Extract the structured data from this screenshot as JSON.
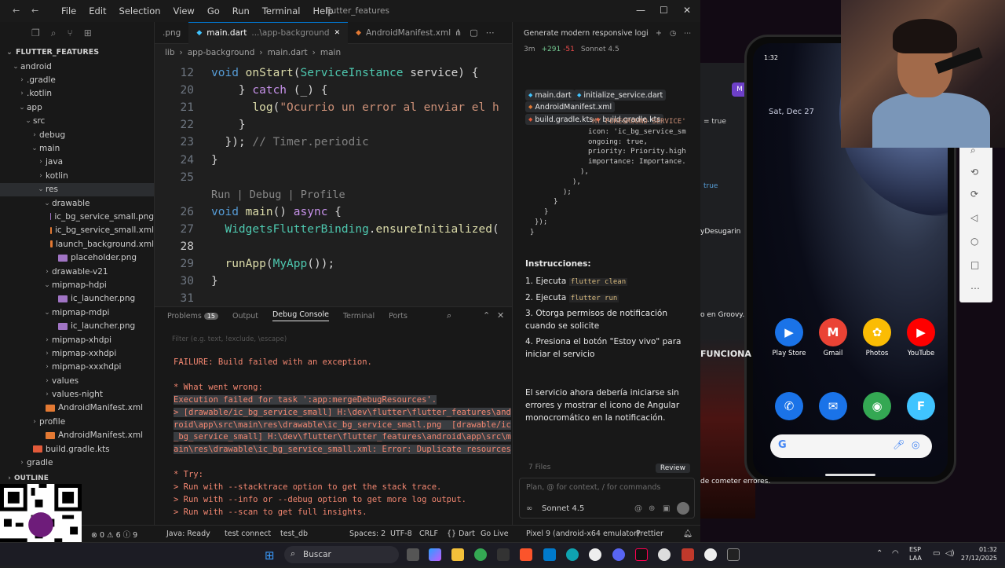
{
  "titlebar": {
    "menu": [
      "File",
      "Edit",
      "Selection",
      "View",
      "Go",
      "Run",
      "Terminal",
      "Help"
    ],
    "title": "flutter_features"
  },
  "explorer": {
    "root": "FLUTTER_FEATURES",
    "items": [
      {
        "label": "android",
        "indent": 1,
        "chev": "⌄",
        "icon": ""
      },
      {
        "label": ".gradle",
        "indent": 2,
        "chev": "›",
        "icon": ""
      },
      {
        "label": ".kotlin",
        "indent": 2,
        "chev": "›",
        "icon": ""
      },
      {
        "label": "app",
        "indent": 2,
        "chev": "⌄",
        "icon": ""
      },
      {
        "label": "src",
        "indent": 3,
        "chev": "⌄",
        "icon": ""
      },
      {
        "label": "debug",
        "indent": 4,
        "chev": "›",
        "icon": ""
      },
      {
        "label": "main",
        "indent": 4,
        "chev": "⌄",
        "icon": ""
      },
      {
        "label": "java",
        "indent": 5,
        "chev": "›",
        "icon": ""
      },
      {
        "label": "kotlin",
        "indent": 5,
        "chev": "›",
        "icon": ""
      },
      {
        "label": "res",
        "indent": 5,
        "chev": "⌄",
        "icon": "",
        "selected": true
      },
      {
        "label": "drawable",
        "indent": 6,
        "chev": "⌄",
        "icon": ""
      },
      {
        "label": "ic_bg_service_small.png",
        "indent": 7,
        "chev": "",
        "icon": "img"
      },
      {
        "label": "ic_bg_service_small.xml",
        "indent": 7,
        "chev": "",
        "icon": "xml"
      },
      {
        "label": "launch_background.xml",
        "indent": 7,
        "chev": "",
        "icon": "xml"
      },
      {
        "label": "placeholder.png",
        "indent": 7,
        "chev": "",
        "icon": "img"
      },
      {
        "label": "drawable-v21",
        "indent": 6,
        "chev": "›",
        "icon": ""
      },
      {
        "label": "mipmap-hdpi",
        "indent": 6,
        "chev": "⌄",
        "icon": ""
      },
      {
        "label": "ic_launcher.png",
        "indent": 7,
        "chev": "",
        "icon": "img"
      },
      {
        "label": "mipmap-mdpi",
        "indent": 6,
        "chev": "⌄",
        "icon": ""
      },
      {
        "label": "ic_launcher.png",
        "indent": 7,
        "chev": "",
        "icon": "img"
      },
      {
        "label": "mipmap-xhdpi",
        "indent": 6,
        "chev": "›",
        "icon": ""
      },
      {
        "label": "mipmap-xxhdpi",
        "indent": 6,
        "chev": "›",
        "icon": ""
      },
      {
        "label": "mipmap-xxxhdpi",
        "indent": 6,
        "chev": "›",
        "icon": ""
      },
      {
        "label": "values",
        "indent": 6,
        "chev": "›",
        "icon": ""
      },
      {
        "label": "values-night",
        "indent": 6,
        "chev": "›",
        "icon": ""
      },
      {
        "label": "AndroidManifest.xml",
        "indent": 5,
        "chev": "",
        "icon": "xml"
      },
      {
        "label": "profile",
        "indent": 4,
        "chev": "›",
        "icon": ""
      },
      {
        "label": "AndroidManifest.xml",
        "indent": 5,
        "chev": "",
        "icon": "xml"
      },
      {
        "label": "build.gradle.kts",
        "indent": 3,
        "chev": "",
        "icon": "kts"
      },
      {
        "label": "gradle",
        "indent": 2,
        "chev": "›",
        "icon": ""
      }
    ],
    "outline": "OUTLINE"
  },
  "tabs": [
    {
      "label": ".png",
      "active": false,
      "kind": ""
    },
    {
      "label": "main.dart",
      "suffix": "...\\app-background",
      "active": true,
      "kind": "dart"
    },
    {
      "label": "AndroidManifest.xml",
      "active": false,
      "kind": "xml"
    }
  ],
  "breadcrumb": [
    "lib",
    "app-background",
    "main.dart",
    "main"
  ],
  "editor": {
    "lines": [
      {
        "n": "12",
        "html": "<span class='kw2'>void</span> <span class='fn'>onStart</span><span class='plain'>(</span><span class='ty'>ServiceInstance</span> <span class='plain'>service) {</span>"
      },
      {
        "n": "20",
        "html": "    <span class='plain'>} </span><span class='kw'>catch</span><span class='plain'> (_) {</span>"
      },
      {
        "n": "21",
        "html": "      <span class='fn'>log</span><span class='plain'>(</span><span class='str'>\"Ocurrio un error al enviar el h</span>"
      },
      {
        "n": "22",
        "html": "    <span class='plain'>}</span>"
      },
      {
        "n": "23",
        "html": "  <span class='plain'>}); </span><span class='cm2'>// Timer.periodic</span>"
      },
      {
        "n": "24",
        "html": "<span class='plain'>}</span>"
      },
      {
        "n": "25",
        "html": ""
      },
      {
        "n": "",
        "html": "<span class='codelens'>Run | Debug | Profile</span>"
      },
      {
        "n": "26",
        "html": "<span class='kw2'>void</span> <span class='fn'>main</span><span class='plain'>() </span><span class='kw'>async</span><span class='plain'> {</span>"
      },
      {
        "n": "27",
        "html": "  <span class='ty'>WidgetsFlutterBinding</span><span class='plain'>.</span><span class='fn'>ensureInitialized</span><span class='plain'>(</span>"
      },
      {
        "n": "28",
        "html": "",
        "current": true
      },
      {
        "n": "29",
        "html": "  <span class='fn'>runApp</span><span class='plain'>(</span><span class='ty'>MyApp</span><span class='plain'>());</span>"
      },
      {
        "n": "30",
        "html": "<span class='plain'>}</span>"
      },
      {
        "n": "31",
        "html": ""
      }
    ]
  },
  "panel": {
    "tabs": [
      "Problems",
      "Output",
      "Debug Console",
      "Terminal",
      "Ports"
    ],
    "problems_count": "15",
    "active_tab": "Debug Console",
    "filter_placeholder": "Filter (e.g. text, !exclude, \\escape)",
    "console": [
      {
        "text": "FAILURE: Build failed with an exception.",
        "cls": "err"
      },
      {
        "text": "",
        "cls": "err"
      },
      {
        "text": "* What went wrong:",
        "cls": "err"
      },
      {
        "text": "Execution failed for task ':app:mergeDebugResources'.",
        "cls": "err hl"
      },
      {
        "text": "> [drawable/ic_bg_service_small] H:\\dev\\flutter\\flutter_features\\and",
        "cls": "err hl"
      },
      {
        "text": "roid\\app\\src\\main\\res\\drawable\\ic_bg_service_small.png  [drawable/ic",
        "cls": "err hl"
      },
      {
        "text": "_bg_service_small] H:\\dev\\flutter\\flutter_features\\android\\app\\src\\m",
        "cls": "err hl"
      },
      {
        "text": "ain\\res\\drawable\\ic_bg_service_small.xml: Error: Duplicate resources",
        "cls": "err hl"
      },
      {
        "text": "",
        "cls": "err"
      },
      {
        "text": "* Try:",
        "cls": "err"
      },
      {
        "text": "> Run with --stacktrace option to get the stack trace.",
        "cls": "err"
      },
      {
        "text": "> Run with --info or --debug option to get more log output.",
        "cls": "err"
      },
      {
        "text": "> Run with --scan to get full insights.",
        "cls": "err"
      }
    ]
  },
  "statusbar": {
    "left": [
      "⊗ 0 ⚠ 6 ⓘ 9",
      "Java: Ready",
      "test connect",
      "test_db"
    ],
    "right": [
      "Spaces: 2",
      "UTF-8",
      "CRLF",
      "{} Dart",
      "Go Live",
      "Pixel 9 (android-x64 emulator)",
      "Prettier"
    ]
  },
  "chat": {
    "title": "Generate modern responsive logi",
    "meta_time": "3m",
    "meta_add": "+291",
    "meta_del": "-51",
    "model_meta": "Sonnet 4.5",
    "chips": [
      {
        "label": "main.dart",
        "kind": "dart"
      },
      {
        "label": "initialize_service.dart",
        "kind": "dart"
      },
      {
        "label": "AndroidManifest.xml",
        "kind": "xml"
      },
      {
        "label": "build.gradle.kts",
        "kind": "kts"
      },
      {
        "label": "build.gradle.kts",
        "kind": "kts"
      }
    ],
    "snippet": [
      "'MY FOREGROUND SERVICE'",
      "icon: 'ic_bg_service_sm",
      "ongoing: true,",
      "priority: Priority.high",
      "importance: Importance.",
      "),",
      "),",
      ");",
      "}",
      "}",
      "});",
      "}"
    ],
    "instructions_title": "Instrucciones:",
    "steps": [
      {
        "pre": "1. Ejecuta ",
        "code": "flutter clean",
        "post": ""
      },
      {
        "pre": "2. Ejecuta ",
        "code": "flutter run",
        "post": ""
      },
      {
        "pre": "3. Otorga permisos de notificación cuando se solicite",
        "code": "",
        "post": ""
      },
      {
        "pre": "4. Presiona el botón \"Estoy vivo\" para iniciar el servicio",
        "code": "",
        "post": ""
      }
    ],
    "summary": "El servicio ahora debería iniciarse sin errores y mostrar el icono de Angular monocromático en la notificación.",
    "files_changed": "7 Files",
    "review": "Review",
    "input_placeholder": "Plan, @ for context, / for commands",
    "model": "Sonnet 4.5"
  },
  "phone": {
    "date": "Sat, Dec 27",
    "apps": [
      {
        "label": "Play Store",
        "color": "#1a73e8",
        "glyph": "▶"
      },
      {
        "label": "Gmail",
        "color": "#ea4335",
        "glyph": "M"
      },
      {
        "label": "Photos",
        "color": "#fbbc04",
        "glyph": "✿"
      },
      {
        "label": "YouTube",
        "color": "#ff0000",
        "glyph": "▶"
      }
    ],
    "dock": [
      {
        "label": "",
        "color": "#1a73e8",
        "glyph": "✆"
      },
      {
        "label": "",
        "color": "#1a73e8",
        "glyph": "✉"
      },
      {
        "label": "",
        "color": "#34a853",
        "glyph": "◉"
      },
      {
        "label": "",
        "color": "#40c4ff",
        "glyph": "F"
      }
    ]
  },
  "background_text": {
    "items": [
      "= true",
      "true",
      "yDesugarin",
      "o en Groovy.",
      "FUNCIONA",
      "de cometer errores."
    ]
  },
  "taskbar": {
    "search": "Buscar",
    "lang": [
      "ESP",
      "LAA"
    ],
    "time": "01:32",
    "date": "27/12/2025"
  }
}
